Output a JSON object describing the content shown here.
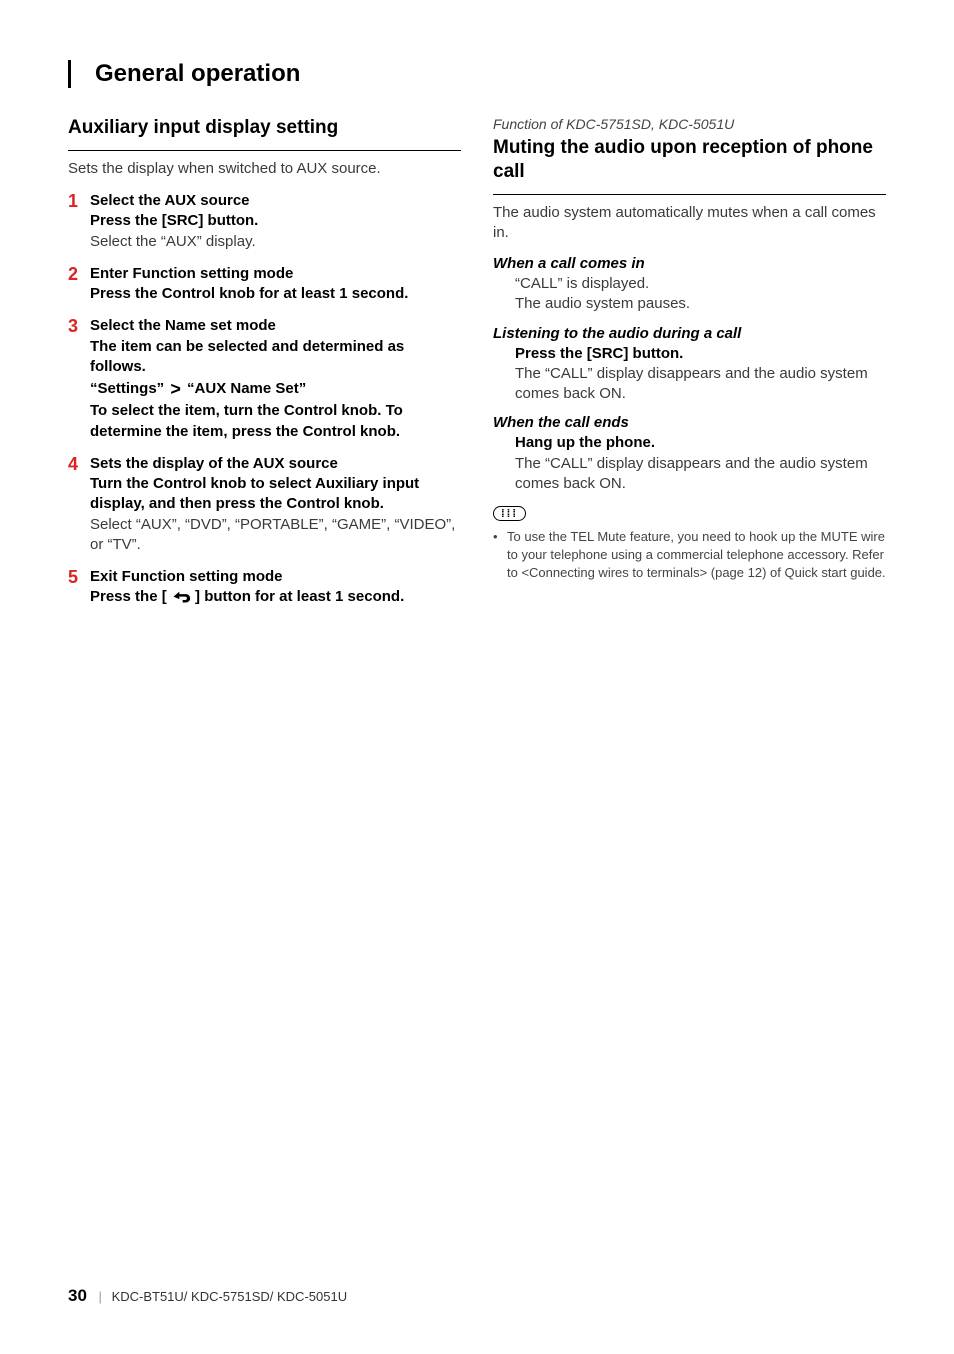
{
  "page_title": "General operation",
  "left": {
    "section_title": "Auxiliary input display setting",
    "intro": "Sets the display when switched to AUX source.",
    "steps": [
      {
        "num": "1",
        "title": "Select the AUX source",
        "bold": "Press the [SRC] button.",
        "plain": "Select the “AUX” display."
      },
      {
        "num": "2",
        "title": "Enter Function setting mode",
        "bold": "Press the Control knob for at least 1 second.",
        "plain": ""
      },
      {
        "num": "3",
        "title": "Select the Name set mode",
        "bold": "The item can be selected and determined as follows.",
        "path_a": "“Settings”",
        "path_b": "“AUX Name Set”",
        "bold2": "To select the item, turn the Control knob. To determine the item, press the Control knob.",
        "plain": ""
      },
      {
        "num": "4",
        "title": "Sets the display of the AUX source",
        "bold": "Turn the Control knob to select Auxiliary input display, and then press the Control knob.",
        "plain": "Select “AUX”, “DVD”, “PORTABLE”, “GAME”, “VIDEO”, or “TV”."
      },
      {
        "num": "5",
        "title": "Exit Function setting mode",
        "bold_pre": "Press the [",
        "bold_post": "] button for at least 1 second.",
        "plain": ""
      }
    ]
  },
  "right": {
    "model_note": "Function of KDC-5751SD, KDC-5051U",
    "section_title": "Muting the audio upon reception of phone call",
    "intro": "The audio system automatically mutes when a call comes in.",
    "sub1": {
      "head": "When a call comes in",
      "line1": "“CALL” is displayed.",
      "line2": "The audio system pauses."
    },
    "sub2": {
      "head": "Listening to the audio during a call",
      "bold": "Press the [SRC] button.",
      "plain": "The “CALL” display disappears and the audio system comes back ON."
    },
    "sub3": {
      "head": "When the call ends",
      "bold": "Hang up the phone.",
      "plain": "The “CALL” display disappears and the audio system comes back ON."
    },
    "note": "To use the TEL Mute feature, you need to hook up the MUTE wire to your telephone using a commercial telephone accessory. Refer to <Connecting wires to terminals> (page 12) of Quick start guide."
  },
  "footer": {
    "page": "30",
    "models": "KDC-BT51U/ KDC-5751SD/ KDC-5051U"
  }
}
